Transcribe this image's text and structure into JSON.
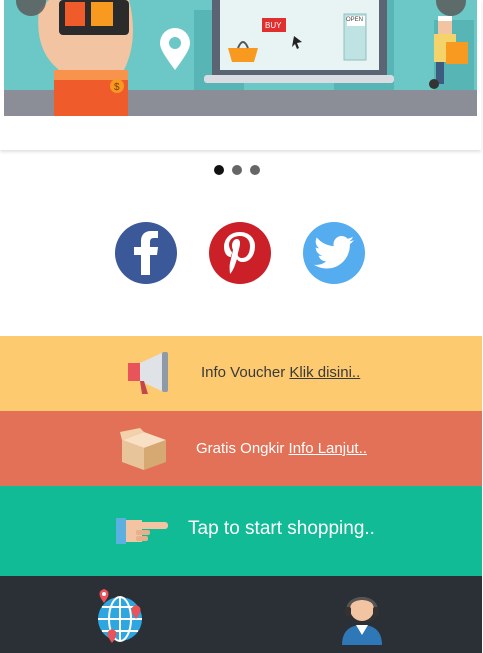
{
  "banner": {
    "buy_label": "BUY",
    "open_label": "OPEN",
    "price_symbol": "$"
  },
  "carousel": {
    "slide_count": 3,
    "active_index": 0
  },
  "social": [
    "facebook-icon",
    "pinterest-icon",
    "twitter-icon"
  ],
  "voucher": {
    "text": "Info Voucher",
    "link": "Klik disini.."
  },
  "shipping": {
    "text": "Gratis Ongkir",
    "link": "Info Lanjut.."
  },
  "shopping": {
    "text": "Tap to start shopping.."
  },
  "colors": {
    "voucher_bg": "#fdca70",
    "shipping_bg": "#e37157",
    "shopping_bg": "#10bb96",
    "footer_bg": "#2b3036",
    "facebook": "#3b5998",
    "pinterest": "#cb2027",
    "twitter": "#55acee"
  },
  "footer": {
    "icons": [
      "globe-location-icon",
      "customer-support-icon"
    ]
  }
}
